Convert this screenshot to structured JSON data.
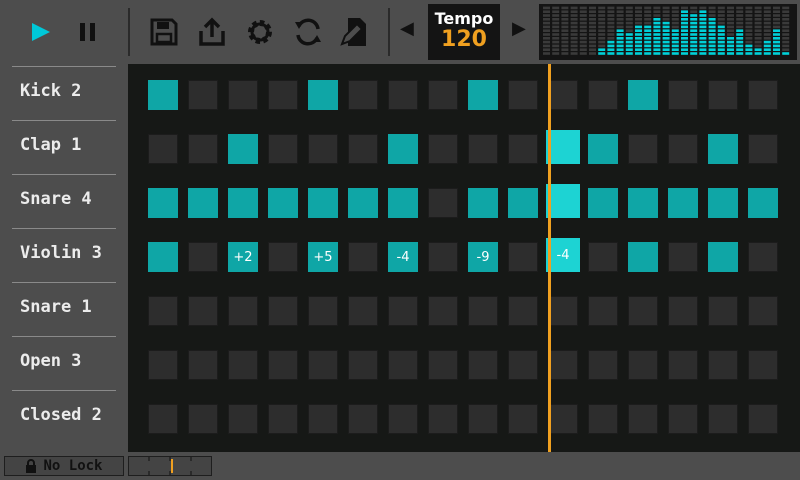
{
  "toolbar": {
    "buttons": [
      {
        "name": "play",
        "icon": "play-icon",
        "color": "#00c8d8"
      },
      {
        "name": "pause",
        "icon": "pause-icon"
      },
      {
        "name": "save",
        "icon": "floppy-disk-icon"
      },
      {
        "name": "export",
        "icon": "share-upload-icon"
      },
      {
        "name": "settings",
        "icon": "gear-icon"
      },
      {
        "name": "sync",
        "icon": "refresh-icon"
      },
      {
        "name": "edit",
        "icon": "file-edit-icon"
      }
    ],
    "tempo_label": "Tempo",
    "tempo_value": "120",
    "prev_icon": "triangle-left-icon",
    "next_icon": "triangle-right-icon"
  },
  "meter": {
    "levels": [
      0,
      0,
      0,
      0,
      0,
      0,
      0.18,
      0.32,
      0.5,
      0.46,
      0.64,
      0.58,
      0.78,
      0.68,
      0.55,
      0.95,
      0.82,
      0.92,
      0.78,
      0.62,
      0.42,
      0.5,
      0.22,
      0.12,
      0.34,
      0.56,
      0.08
    ],
    "accent": "#00d0d8"
  },
  "tracks": [
    "Kick 2",
    "Clap 1",
    "Snare 4",
    "Violin 3",
    "Snare 1",
    "Open 3",
    "Closed 2"
  ],
  "pattern": [
    [
      1,
      0,
      0,
      0,
      1,
      0,
      0,
      0,
      1,
      0,
      0,
      0,
      1,
      0,
      0,
      0
    ],
    [
      0,
      0,
      1,
      0,
      0,
      0,
      1,
      0,
      0,
      0,
      1,
      1,
      0,
      0,
      1,
      0
    ],
    [
      1,
      1,
      1,
      1,
      1,
      1,
      1,
      0,
      1,
      1,
      1,
      1,
      1,
      1,
      1,
      1
    ],
    [
      1,
      0,
      1,
      0,
      1,
      0,
      1,
      0,
      1,
      0,
      1,
      0,
      1,
      0,
      1,
      0
    ],
    [
      0,
      0,
      0,
      0,
      0,
      0,
      0,
      0,
      0,
      0,
      0,
      0,
      0,
      0,
      0,
      0
    ],
    [
      0,
      0,
      0,
      0,
      0,
      0,
      0,
      0,
      0,
      0,
      0,
      0,
      0,
      0,
      0,
      0
    ],
    [
      0,
      0,
      0,
      0,
      0,
      0,
      0,
      0,
      0,
      0,
      0,
      0,
      0,
      0,
      0,
      0
    ]
  ],
  "cell_labels": {
    "3": [
      "",
      "",
      "+2",
      "",
      "+5",
      "",
      "-4",
      "",
      "-9",
      "",
      "-4",
      "",
      "",
      "",
      "",
      ""
    ]
  },
  "current_step": 10,
  "colors": {
    "on": "#0fa6a6",
    "playing": "#1dd3d3",
    "playhead": "#f0a020",
    "tempo": "#f0a020"
  },
  "status": {
    "lock_label": "No Lock",
    "lock_icon": "lock-icon"
  }
}
